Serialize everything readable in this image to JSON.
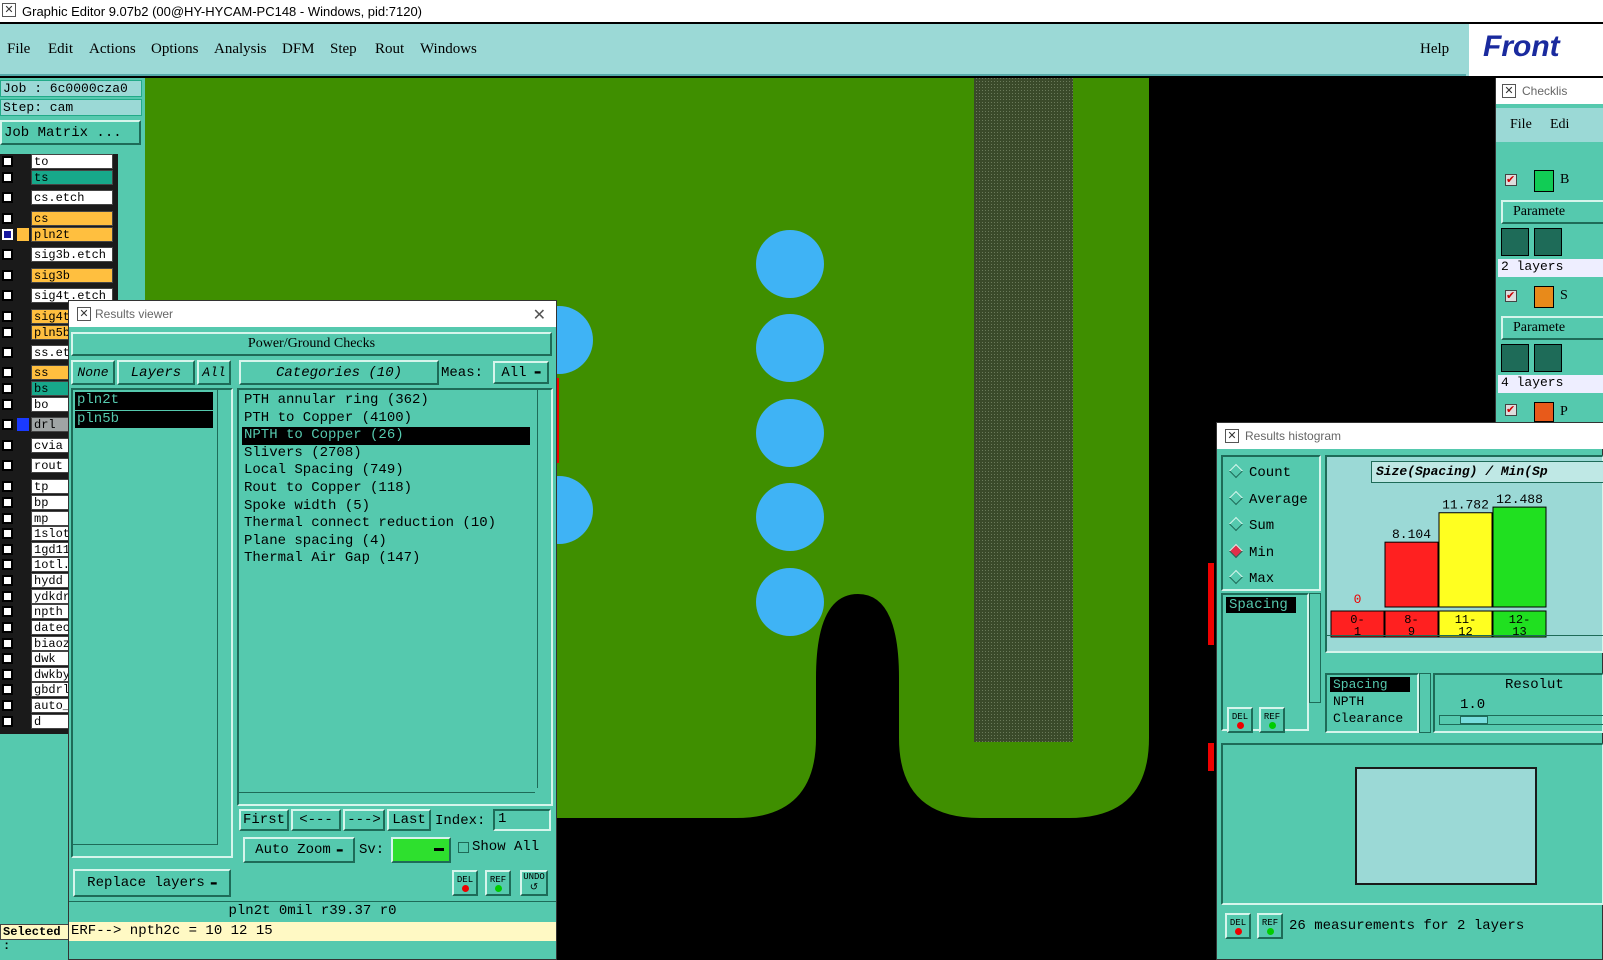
{
  "window_title": "Graphic Editor 9.07b2 (00@HY-HYCAM-PC148 - Windows, pid:7120)",
  "menu": [
    "File",
    "Edit",
    "Actions",
    "Options",
    "Analysis",
    "DFM",
    "Step",
    "Rout",
    "Windows"
  ],
  "help": "Help",
  "logo": "Front",
  "job": "Job :  6c0000cza0",
  "step": "Step:  cam",
  "job_matrix": "Job Matrix ...",
  "layers": [
    {
      "name": "to",
      "color": "#ffffff"
    },
    {
      "name": "ts",
      "color": "#17a88a"
    },
    {
      "name": "cs.etch",
      "color": "#ffffff"
    },
    {
      "name": "cs",
      "color": "#ffbf3f"
    },
    {
      "name": "pln2t",
      "color": "#ffbf3f",
      "active": true
    },
    {
      "name": "sig3b.etch",
      "color": "#ffffff"
    },
    {
      "name": "sig3b",
      "color": "#ffbf3f"
    },
    {
      "name": "sig4t.etch",
      "color": "#ffffff"
    },
    {
      "name": "sig4t",
      "color": "#ffbf3f"
    },
    {
      "name": "pln5b",
      "color": "#ffbf3f"
    },
    {
      "name": "ss.etch",
      "color": "#ffffff"
    },
    {
      "name": "ss",
      "color": "#ffbf3f"
    },
    {
      "name": "bs",
      "color": "#17a88a"
    },
    {
      "name": "bo",
      "color": "#ffffff"
    },
    {
      "name": "drl",
      "color": "#9fa4a4",
      "dot": "#1a3aff"
    },
    {
      "name": "cvia",
      "color": "#ffffff"
    },
    {
      "name": "rout",
      "color": "#ffffff"
    },
    {
      "name": "tp",
      "color": "#ffffff"
    },
    {
      "name": "bp",
      "color": "#ffffff"
    },
    {
      "name": "mp",
      "color": "#ffffff"
    },
    {
      "name": "1slot",
      "color": "#ffffff"
    },
    {
      "name": "1gd11",
      "color": "#ffffff"
    },
    {
      "name": "1otl.",
      "color": "#ffffff"
    },
    {
      "name": "hydd",
      "color": "#ffffff"
    },
    {
      "name": "ydkdr",
      "color": "#ffffff"
    },
    {
      "name": "npth",
      "color": "#ffffff"
    },
    {
      "name": "datec",
      "color": "#ffffff"
    },
    {
      "name": "biaoz",
      "color": "#ffffff"
    },
    {
      "name": "dwk",
      "color": "#ffffff"
    },
    {
      "name": "dwkby",
      "color": "#ffffff"
    },
    {
      "name": "gbdrl",
      "color": "#ffffff"
    },
    {
      "name": "auto_",
      "color": "#ffffff"
    },
    {
      "name": "d",
      "color": "#ffffff"
    }
  ],
  "selected_label": "Selected :",
  "results_viewer": {
    "title": "Results viewer",
    "header": "Power/Ground Checks",
    "none": "None",
    "layers_btn": "Layers",
    "all_btn": "All",
    "layer_list": [
      "pln2t",
      "pln5b"
    ],
    "categories_btn": "Categories (10)",
    "meas_label": "Meas:",
    "meas_value": "All",
    "categories": [
      "PTH annular ring (362)",
      "PTH to Copper (4100)",
      "NPTH to Copper (26)",
      "Slivers (2708)",
      "Local Spacing (749)",
      "Rout to Copper (118)",
      "Spoke width (5)",
      "Thermal connect reduction (10)",
      "Plane spacing (4)",
      "Thermal Air Gap (147)"
    ],
    "selected_category": 2,
    "first": "First",
    "prev": "<---",
    "next": "--->",
    "last": "Last",
    "index_label": "Index:",
    "index_value": "1",
    "auto_zoom": "Auto Zoom",
    "sv_label": "Sv:",
    "show_all": "Show All",
    "replace_layers": "Replace layers",
    "del": "DEL",
    "ref": "REF",
    "undo": "UNDO",
    "status": "pln2t  0mil   r39.37   r0",
    "erf": "ERF--> npth2c = 10 12 15"
  },
  "checklist": {
    "title": "Checklis",
    "file": "File",
    "edit": "Edi",
    "item1": "B",
    "param1": "Paramete",
    "layers1": "2 layers",
    "item2": "S",
    "param2": "Paramete",
    "layers2": "4 layers",
    "item3": "P"
  },
  "histogram": {
    "title": "Results histogram",
    "modes": [
      "Count",
      "Average",
      "Sum",
      "Min",
      "Max"
    ],
    "selected_mode": 3,
    "list": [
      "Spacing"
    ],
    "chart_title": "Size(Spacing) / Min(Sp",
    "chart_data": {
      "type": "bar",
      "title": "Size(Spacing) / Min(Sp",
      "categories": [
        "0-\n1",
        "8-\n9",
        "11-\n12",
        "12-\n13"
      ],
      "values": [
        0,
        8.104,
        11.782,
        12.488
      ],
      "labels": [
        "0",
        "8.104",
        "11.782",
        "12.488"
      ],
      "colors": [
        "#ff2020",
        "#ff2020",
        "#ffff20",
        "#20e020"
      ],
      "ylim": [
        0,
        13.5
      ]
    },
    "lower_list": [
      "Spacing",
      "NPTH",
      "Clearance"
    ],
    "resolution_label": "Resolut",
    "resolution_value": "1.0",
    "measurements": "26 measurements for 2 layers",
    "del": "DEL",
    "ref": "REF"
  }
}
